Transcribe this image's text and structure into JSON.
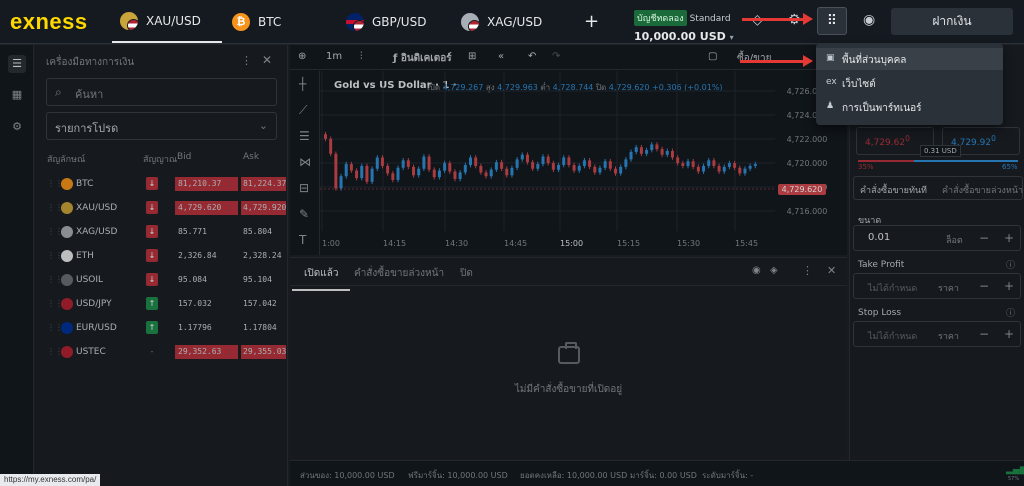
{
  "brand": {
    "logo": "exness"
  },
  "tabs": [
    {
      "label": "XAU/USD",
      "flag": "xau"
    },
    {
      "label": "BTC",
      "flag": "btc",
      "glyph": "₿"
    },
    {
      "label": "GBP/USD",
      "flag": "gbp"
    },
    {
      "label": "XAG/USD",
      "flag": "xag"
    }
  ],
  "add_tab": "+",
  "account": {
    "type_badge": "บัญชีทดลอง",
    "plan": "Standard",
    "balance": "10,000.00 USD"
  },
  "deposit_label": "ฝากเงิน",
  "menu": {
    "items": [
      {
        "label": "พื้นที่ส่วนบุคคล",
        "icon": "user-area-icon"
      },
      {
        "label": "เว็บไซต์",
        "icon": "website-icon",
        "prefix": "ex"
      },
      {
        "label": "การเป็นพาร์ทเนอร์",
        "icon": "partner-icon"
      }
    ]
  },
  "watchlist": {
    "title": "เครื่องมือทางการเงิน",
    "search_placeholder": "ค้นหา",
    "filter": "รายการโปรด",
    "headers": {
      "symbol": "สัญลักษณ์",
      "signal": "สัญญาณ",
      "bid": "Bid",
      "ask": "Ask"
    },
    "rows": [
      {
        "symbol": "BTC",
        "signal": "↓",
        "sig_color": "red",
        "bid": "81,210.37",
        "ask": "81,224.37",
        "bid_hl": "red",
        "ask_hl": "red",
        "icon": "#f7931a"
      },
      {
        "symbol": "XAU/USD",
        "signal": "↓",
        "sig_color": "red",
        "bid": "4,729.620",
        "ask": "4,729.920",
        "bid_hl": "red",
        "ask_hl": "red",
        "icon": "#c9a43a"
      },
      {
        "symbol": "XAG/USD",
        "signal": "↓",
        "sig_color": "red",
        "bid": "85.771",
        "ask": "85.804",
        "bid_hl": "",
        "ask_hl": "",
        "icon": "#a7aeb5"
      },
      {
        "symbol": "ETH",
        "signal": "↓",
        "sig_color": "red",
        "bid": "2,326.84",
        "ask": "2,328.24",
        "bid_hl": "",
        "ask_hl": "",
        "icon": "#e6e8ea"
      },
      {
        "symbol": "USOIL",
        "signal": "↓",
        "sig_color": "red",
        "bid": "95.084",
        "ask": "95.104",
        "bid_hl": "",
        "ask_hl": "",
        "icon": "#6a7077"
      },
      {
        "symbol": "USD/JPY",
        "signal": "↑",
        "sig_color": "green",
        "bid": "157.032",
        "ask": "157.042",
        "bid_hl": "",
        "ask_hl": "",
        "icon": "#b22234"
      },
      {
        "symbol": "EUR/USD",
        "signal": "↑",
        "sig_color": "green",
        "bid": "1.17796",
        "ask": "1.17804",
        "bid_hl": "",
        "ask_hl": "",
        "icon": "#003399"
      },
      {
        "symbol": "USTEC",
        "signal": "-",
        "sig_color": "",
        "bid": "29,352.63",
        "ask": "29,355.03",
        "bid_hl": "red",
        "ask_hl": "red",
        "icon": "#b22234"
      }
    ]
  },
  "chart_toolbar": {
    "timeframe": "1m",
    "indicators": "อินดิเคเตอร์",
    "flag_label": "ซื้อ/ขาย"
  },
  "chart_data": {
    "type": "candlestick",
    "title": "Gold vs US Dollar · 1 ·",
    "ohlc": {
      "o_label": "เปิด",
      "o": "4,729.267",
      "h_label": "สูง",
      "h": "4,729.963",
      "l_label": "ต่ำ",
      "l": "4,728.744",
      "c_label": "ปิด",
      "c": "4,729.620",
      "change": "+0.306 (+0.01%)"
    },
    "y_ticks": [
      "4,726.000",
      "4,724.000",
      "4,722.000",
      "4,720.000",
      "4,718.000",
      "4,716.000"
    ],
    "ylim": [
      4715,
      4727
    ],
    "x_ticks": [
      "1:00",
      "14:15",
      "14:30",
      "14:45",
      "15:00",
      "15:15",
      "15:30",
      "15:45"
    ],
    "last_price": "4,729.620",
    "closes": [
      4723.8,
      4722.2,
      4718.5,
      4719.8,
      4721.1,
      4720.4,
      4719.6,
      4720.9,
      4719.2,
      4720.6,
      4721.8,
      4720.9,
      4720.1,
      4719.4,
      4720.7,
      4721.5,
      4720.8,
      4719.9,
      4720.6,
      4721.9,
      4720.5,
      4719.7,
      4720.4,
      4721.2,
      4720.3,
      4719.5,
      4720.2,
      4721.0,
      4721.8,
      4720.9,
      4720.2,
      4719.8,
      4720.5,
      4721.3,
      4720.6,
      4719.9,
      4720.7,
      4721.6,
      4722.1,
      4721.3,
      4720.6,
      4721.1,
      4721.9,
      4721.2,
      4720.5,
      4721.0,
      4721.8,
      4721.0,
      4720.4,
      4720.9,
      4721.5,
      4720.8,
      4720.2,
      4720.7,
      4721.4,
      4720.6,
      4720.1,
      4720.8,
      4721.6,
      4722.4,
      4722.9,
      4722.2,
      4722.6,
      4723.2,
      4722.7,
      4722.1,
      4722.5,
      4721.8,
      4721.2,
      4720.9,
      4721.4,
      4720.8,
      4720.3,
      4720.9,
      4721.5,
      4720.9,
      4720.3,
      4720.8,
      4721.2,
      4720.7,
      4720.1,
      4720.6,
      4720.9,
      4721.1
    ]
  },
  "bottom_panel": {
    "tabs": [
      "เปิดแล้ว",
      "คำสั่งซื้อขายล่วงหน้า",
      "ปิด"
    ],
    "empty_text": "ไม่มีคำสั่งซื้อขายที่เปิดอยู่"
  },
  "status_bar": {
    "equity": "ส่วนของ: 10,000.00 USD",
    "free_margin": "ฟรีมาร์จิ้น: 10,000.00 USD",
    "balance": "ยอดคงเหลือ: 10,000.00 USD",
    "margin": "มาร์จิ้น: 0.00 USD",
    "margin_level": "ระดับมาร์จิ้น: -"
  },
  "order_panel": {
    "sell_price": "4,729.62",
    "sell_sup": "0",
    "buy_price": "4,729.92",
    "buy_sup": "0",
    "spread": "0.31 USD",
    "sell_pct": "35%",
    "buy_pct": "65%",
    "tab_market": "คำสั่งซื้อขายทันที",
    "tab_pending": "คำสั่งซื้อขายล่วงหน้า",
    "volume_label": "ขนาด",
    "volume_value": "0.01",
    "volume_unit": "ล็อต",
    "tp_label": "Take Profit",
    "sl_label": "Stop Loss",
    "not_set": "ไม่ได้กำหนด",
    "price_unit": "ราคา"
  },
  "url_status": "https://my.exness.com/pa/",
  "signal_label": "57%"
}
